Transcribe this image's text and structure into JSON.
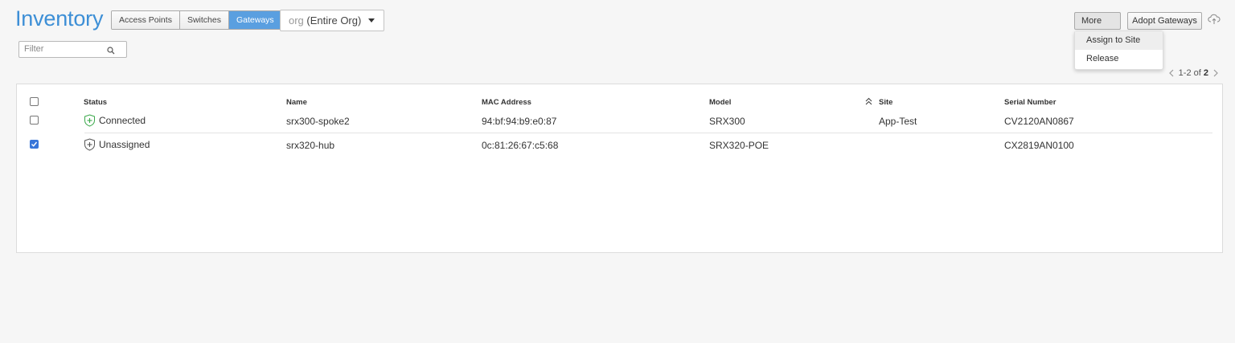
{
  "header": {
    "title": "Inventory",
    "tabs": [
      "Access Points",
      "Switches",
      "Gateways"
    ],
    "active_tab": "Gateways",
    "org_prefix": "org",
    "org_value": "(Entire Org)",
    "filter_placeholder": "Filter"
  },
  "toolbar": {
    "more_label": "More",
    "adopt_label": "Adopt Gateways",
    "menu_items": [
      "Assign to Site",
      "Release"
    ]
  },
  "pager": {
    "range": "1-2 of",
    "total": "2"
  },
  "table": {
    "columns": [
      "Status",
      "Name",
      "MAC Address",
      "Model",
      "Site",
      "Serial Number"
    ],
    "rows": [
      {
        "checked": false,
        "status": "Connected",
        "name": "srx300-spoke2",
        "mac": "94:bf:94:b9:e0:87",
        "model": "SRX300",
        "site": "App-Test",
        "serial": "CV2120AN0867"
      },
      {
        "checked": true,
        "status": "Unassigned",
        "name": "srx320-hub",
        "mac": "0c:81:26:67:c5:68",
        "model": "SRX320-POE",
        "site": "",
        "serial": "CX2819AN0100"
      }
    ]
  },
  "colors": {
    "accent": "#3d8fd6",
    "active_tab": "#5a9fe0",
    "connected": "#3aa84a",
    "checkbox": "#3876d9"
  },
  "icons": {
    "search": "search-icon",
    "cloud": "cloud-upload-icon",
    "sort": "sort-icon",
    "status": "shield-plus-icon"
  }
}
